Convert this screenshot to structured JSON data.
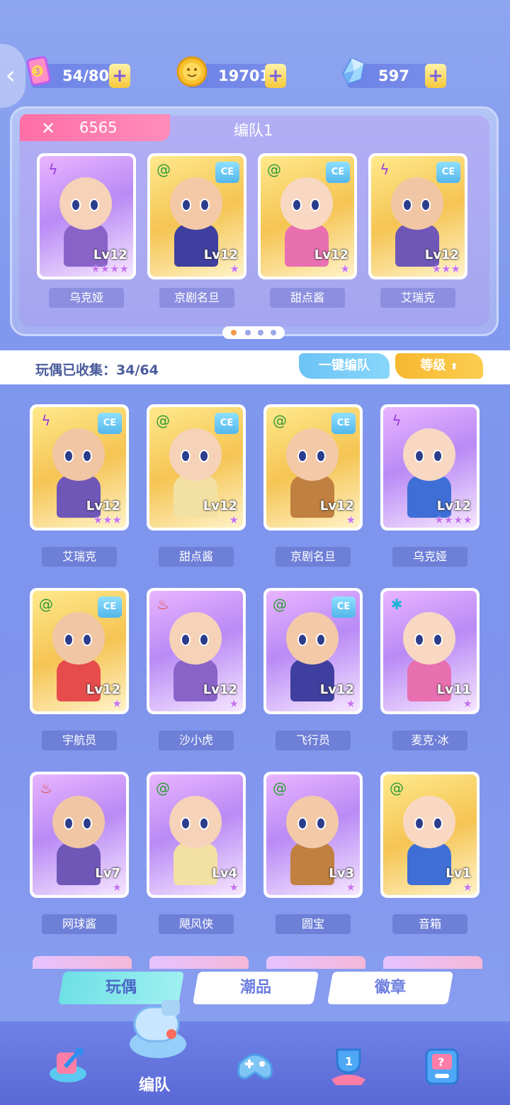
{
  "resources": [
    {
      "name": "stamina",
      "icon": "stamina-card-icon",
      "value": "54/80"
    },
    {
      "name": "coins",
      "icon": "coin-icon",
      "value": "19701"
    },
    {
      "name": "crystals",
      "icon": "crystal-icon",
      "value": "597"
    }
  ],
  "team": {
    "power_value": "6565",
    "title": "编队1",
    "members": [
      {
        "name": "乌克娅",
        "level": "Lv12",
        "element": "thunder",
        "stars": "★★★★",
        "ce": false,
        "theme": "purple"
      },
      {
        "name": "京剧名旦",
        "level": "Lv12",
        "element": "wind",
        "stars": "★",
        "ce": true,
        "theme": "gold"
      },
      {
        "name": "甜点酱",
        "level": "Lv12",
        "element": "wind",
        "stars": "★",
        "ce": true,
        "theme": "gold"
      },
      {
        "name": "艾瑞克",
        "level": "Lv12",
        "element": "thunder",
        "stars": "★★★",
        "ce": true,
        "theme": "gold"
      }
    ],
    "page_dots": 4,
    "active_dot": 0
  },
  "collection": {
    "text": "玩偶已收集：34/64",
    "auto_button": "一键编队",
    "sort_button": "等级"
  },
  "grid": [
    {
      "name": "艾瑞克",
      "level": "Lv12",
      "element": "thunder",
      "stars": "★★★",
      "ce": true,
      "theme": "gold"
    },
    {
      "name": "甜点酱",
      "level": "Lv12",
      "element": "wind",
      "stars": "★",
      "ce": true,
      "theme": "gold"
    },
    {
      "name": "京剧名旦",
      "level": "Lv12",
      "element": "wind",
      "stars": "★",
      "ce": true,
      "theme": "gold"
    },
    {
      "name": "乌克娅",
      "level": "Lv12",
      "element": "thunder",
      "stars": "★★★★",
      "ce": false,
      "theme": "purple"
    },
    {
      "name": "宇航员",
      "level": "Lv12",
      "element": "wind",
      "stars": "★",
      "ce": true,
      "theme": "gold"
    },
    {
      "name": "沙小虎",
      "level": "Lv12",
      "element": "fire",
      "stars": "★",
      "ce": false,
      "theme": "purple"
    },
    {
      "name": "飞行员",
      "level": "Lv12",
      "element": "wind",
      "stars": "★",
      "ce": true,
      "theme": "purple"
    },
    {
      "name": "麦克·冰",
      "level": "Lv11",
      "element": "ice",
      "stars": "★",
      "ce": false,
      "theme": "purple"
    },
    {
      "name": "网球酱",
      "level": "Lv7",
      "element": "fire",
      "stars": "★",
      "ce": false,
      "theme": "purple"
    },
    {
      "name": "飓风侠",
      "level": "Lv4",
      "element": "wind",
      "stars": "★",
      "ce": false,
      "theme": "purple"
    },
    {
      "name": "圆宝",
      "level": "Lv3",
      "element": "wind",
      "stars": "★",
      "ce": false,
      "theme": "purple"
    },
    {
      "name": "音箱",
      "level": "Lv1",
      "element": "wind",
      "stars": "★",
      "ce": false,
      "theme": "gold"
    }
  ],
  "tabs": [
    "玩偶",
    "潮品",
    "徽章"
  ],
  "active_tab": 0,
  "nav": {
    "active_label": "编队",
    "items": [
      "upgrade-arrow-icon",
      "whistle-icon",
      "gamepad-icon",
      "trophy-icon",
      "mystery-box-icon"
    ]
  },
  "colors": {
    "accent_pink": "#ff6fa5",
    "accent_cyan": "#6ee0e5",
    "accent_gold": "#f7b831",
    "name_tag": "#6e7fd8"
  }
}
